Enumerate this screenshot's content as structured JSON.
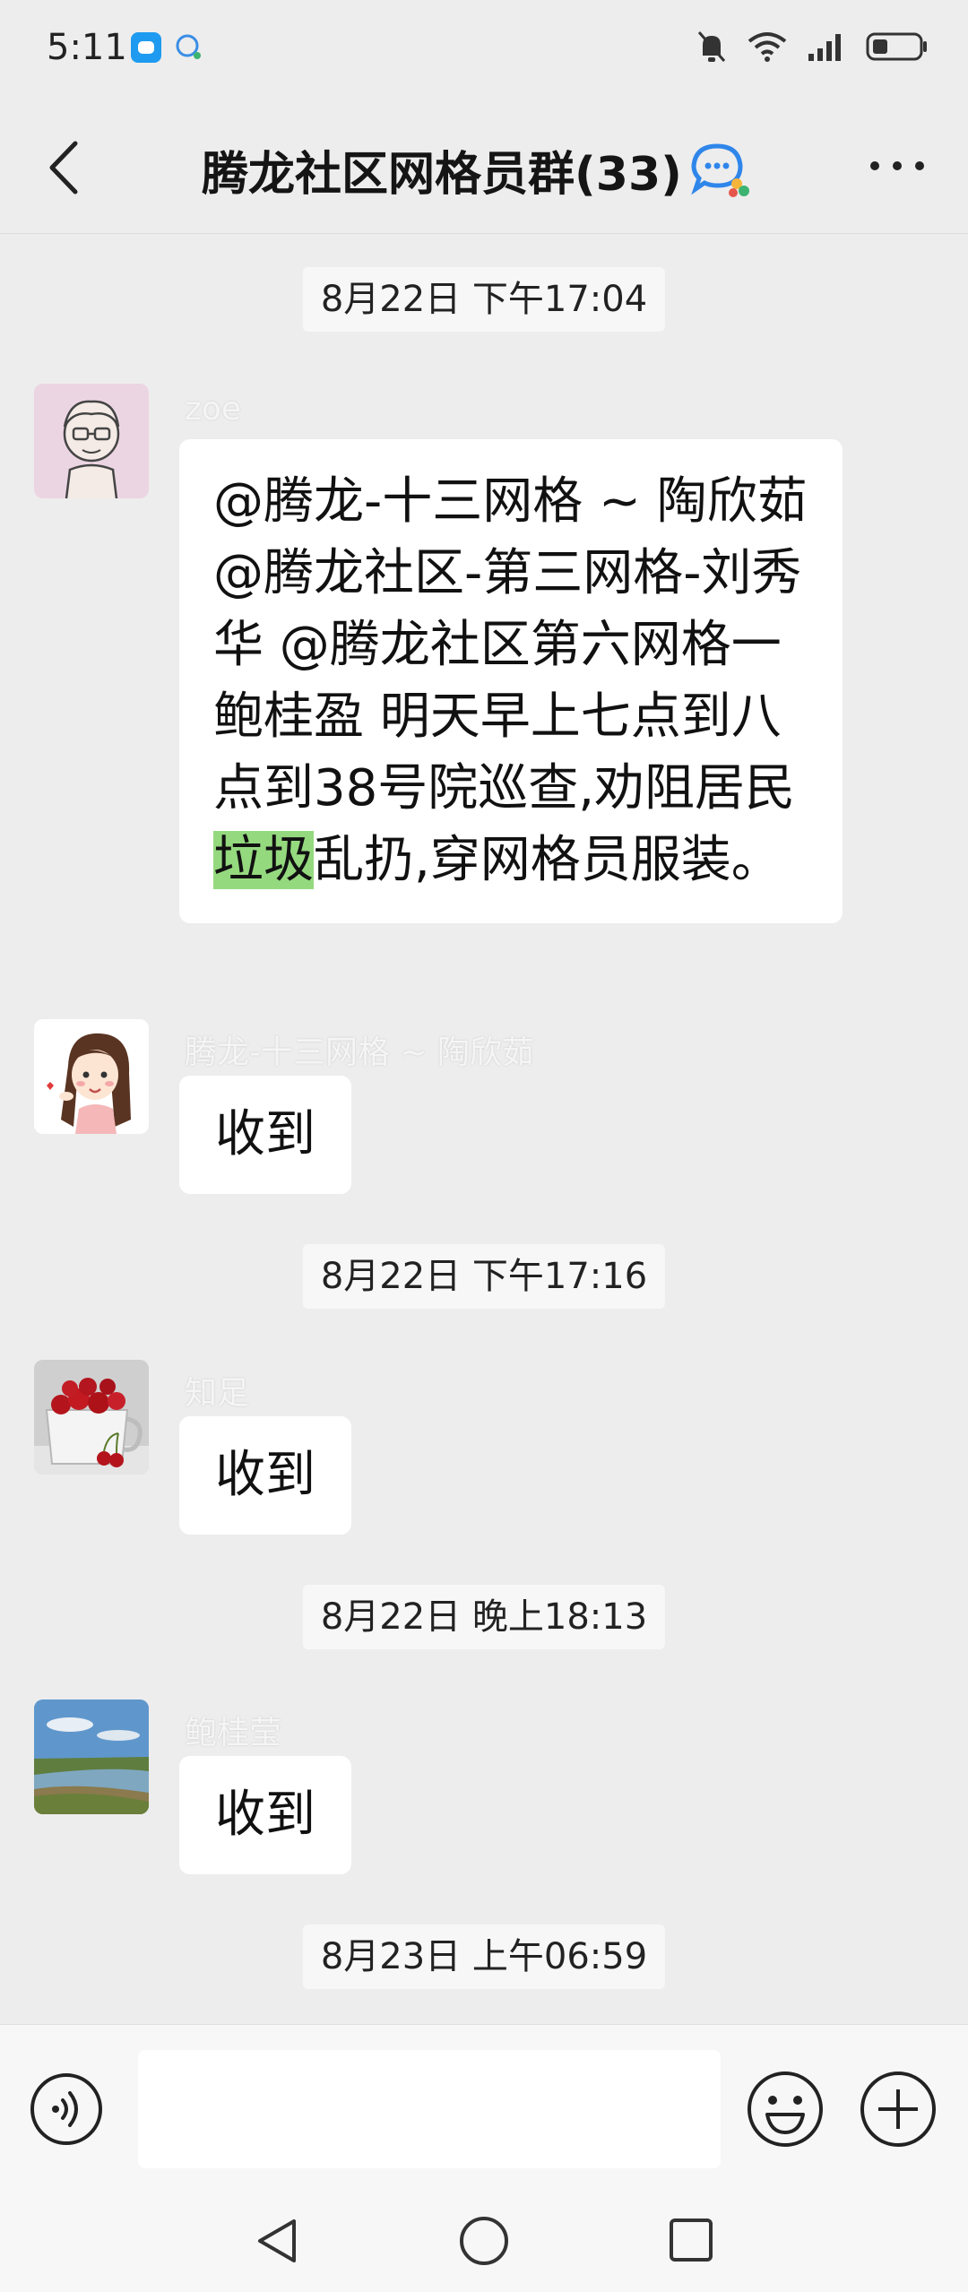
{
  "status_bar": {
    "time": "5:11"
  },
  "header": {
    "title": "腾龙社区网格员群(33)"
  },
  "messages": [
    {
      "time": "8月22日 下午17:04",
      "sender": "zoe",
      "text_before": "@腾龙-十三网格 ~ 陶欣茹 @腾龙社区-第三网格-刘秀华 @腾龙社区第六网格一鲍桂盈  明天早上七点到八点到38号院巡查,劝阻居民",
      "text_highlight": "垃圾",
      "text_after": "乱扔,穿网格员服装。"
    },
    {
      "sender": "腾龙-十三网格 ~ 陶欣茹",
      "text": "收到"
    },
    {
      "time": "8月22日 下午17:16",
      "sender": "知足",
      "text": "收到"
    },
    {
      "time": "8月22日 晚上18:13",
      "sender": "鲍桂莹",
      "text": "收到"
    },
    {
      "time": "8月23日 上午06:59"
    }
  ],
  "input": {
    "value": ""
  },
  "icons": {
    "back": "back-arrow-icon",
    "more": "more-dots-icon",
    "voice": "voice-icon",
    "emoji": "emoji-icon",
    "plus": "plus-icon"
  },
  "colors": {
    "background": "#ededed",
    "bubble": "#ffffff",
    "highlight": "#95d97f"
  }
}
